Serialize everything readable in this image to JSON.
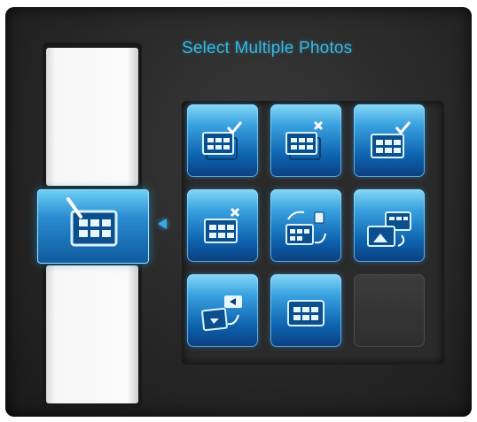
{
  "screen": {
    "title": "Select Multiple Photos"
  },
  "colors": {
    "accent": "#35b8e4",
    "button_top": "#86d8f6",
    "button_bottom": "#0a3f80",
    "frame": "#2a2a2a"
  },
  "side_menu": {
    "selected_icon": "edit-grid-icon"
  },
  "grid_buttons": [
    {
      "icon": "select-multiple-check-icon"
    },
    {
      "icon": "select-multiple-cross-icon"
    },
    {
      "icon": "select-check-icon"
    },
    {
      "icon": "deselect-cross-icon"
    },
    {
      "icon": "move-photos-icon"
    },
    {
      "icon": "copy-photos-icon"
    },
    {
      "icon": "send-photos-icon"
    },
    {
      "icon": "grid-view-icon"
    },
    {
      "icon": "empty-slot"
    }
  ]
}
